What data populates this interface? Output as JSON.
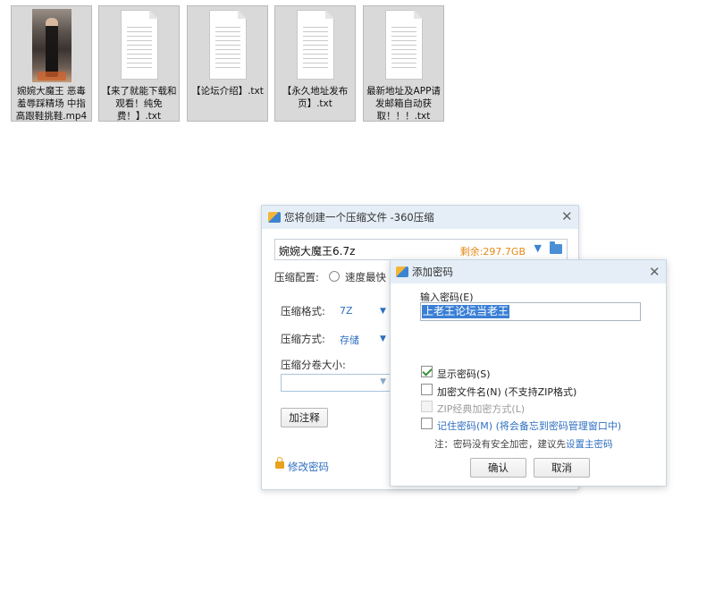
{
  "desktop": {
    "files": [
      {
        "icon": "video-thumbnail-icon",
        "name": "婉婉大魔王 恶毒羞辱踩精场 中指高跟鞋挑鞋.mp4"
      },
      {
        "icon": "text-file-icon",
        "name": "【来了就能下载和观看！纯免费！】.txt"
      },
      {
        "icon": "text-file-icon",
        "name": "【论坛介绍】.txt"
      },
      {
        "icon": "text-file-icon",
        "name": "【永久地址发布页】.txt"
      },
      {
        "icon": "text-file-icon",
        "name": "最新地址及APP请发邮箱自动获取！！！.txt"
      }
    ]
  },
  "compress_dialog": {
    "title": "您将创建一个压缩文件 -360压缩",
    "close": "✕",
    "filename": "婉婉大魔王6.7z",
    "free_space": "剩余:297.7GB",
    "config_label": "压缩配置:",
    "config_option": "速度最快",
    "format_label": "压缩格式:",
    "format_value": "7Z",
    "method_label": "压缩方式:",
    "method_value": "存储",
    "split_label": "压缩分卷大小:",
    "split_value": "",
    "add_comment": "加注释",
    "change_password": "修改密码"
  },
  "password_dialog": {
    "title": "添加密码",
    "close": "✕",
    "input_label": "输入密码(E)",
    "password_value": "上老王论坛当老王",
    "options": {
      "show_password": {
        "label": "显示密码(S)",
        "checked": true
      },
      "encrypt_filenames": {
        "label": "加密文件名(N) (不支持ZIP格式)",
        "checked": false
      },
      "zip_classic": {
        "label": "ZIP经典加密方式(L)",
        "checked": false,
        "disabled": true
      },
      "remember": {
        "label": "记住密码(M) (将会备忘到密码管理窗口中)",
        "checked": false
      }
    },
    "note_prefix": "注：密码没有安全加密，建议先",
    "note_link": "设置主密码",
    "ok": "确认",
    "cancel": "取消"
  },
  "colors": {
    "accent": "#2f6fc1",
    "titlebar": "#e5eef7",
    "space": "#e58a17"
  }
}
